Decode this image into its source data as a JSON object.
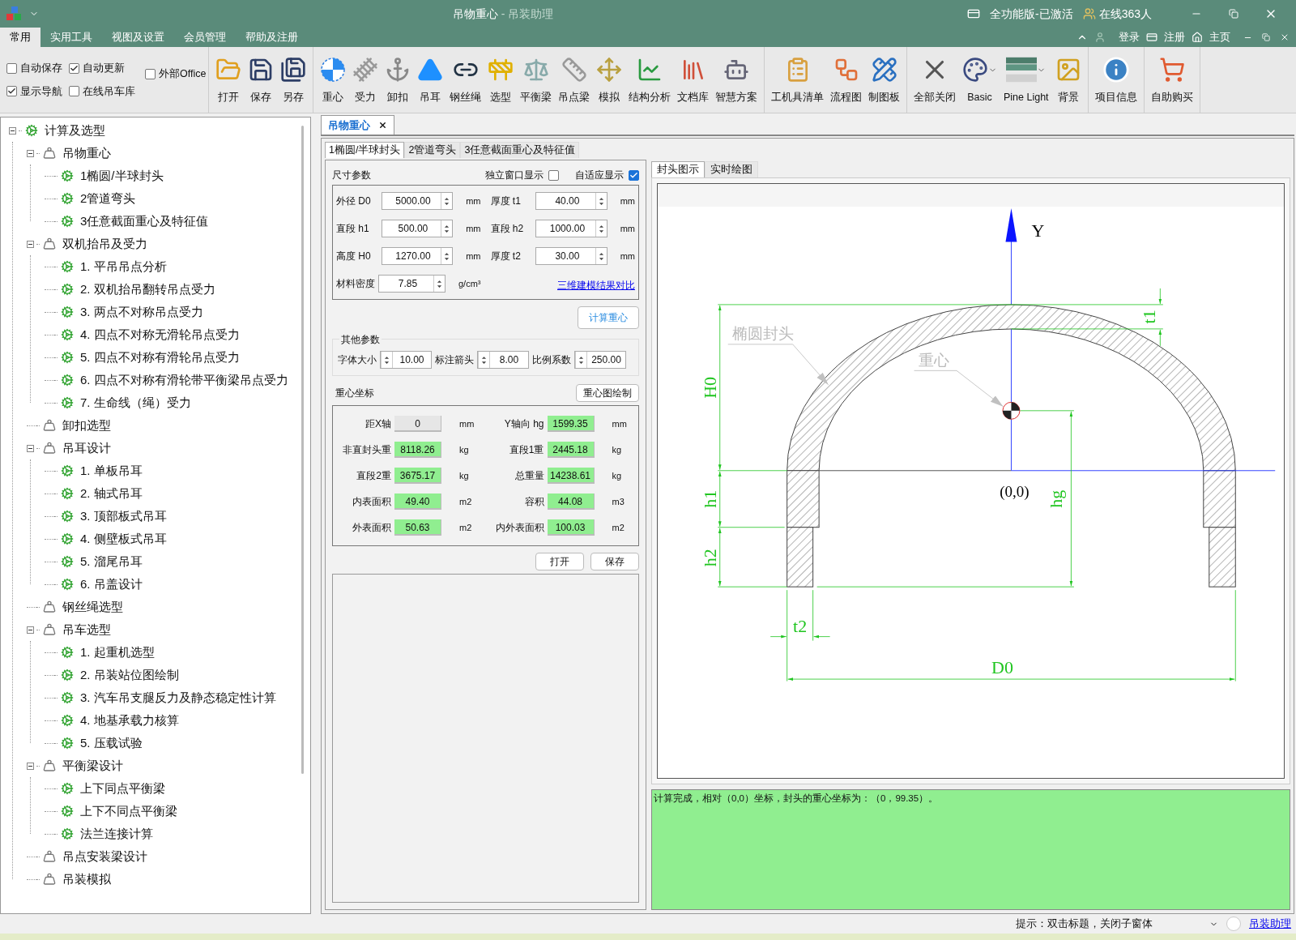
{
  "title_bar": {
    "title": "吊物重心",
    "subtitle": " - 吊装助理",
    "license": "全功能版-已激活",
    "online": "在线363人"
  },
  "ribbon_tabs": [
    {
      "label": "常用",
      "selected": true
    },
    {
      "label": "实用工具",
      "selected": false
    },
    {
      "label": "视图及设置",
      "selected": false
    },
    {
      "label": "会员管理",
      "selected": false
    },
    {
      "label": "帮助及注册",
      "selected": false
    }
  ],
  "account": {
    "login": "登录",
    "register": "注册",
    "home": "主页"
  },
  "ribbon_checks": [
    {
      "label": "自动保存",
      "checked": false
    },
    {
      "label": "自动更新",
      "checked": true
    },
    {
      "label": "外部Office",
      "checked": false
    },
    {
      "label": "显示导航",
      "checked": true
    },
    {
      "label": "在线吊车库",
      "checked": false
    }
  ],
  "ribbon_groups": [
    [
      {
        "label": "打开",
        "kind": "button"
      },
      {
        "label": "保存",
        "kind": "button"
      },
      {
        "label": "另存",
        "kind": "button"
      }
    ],
    [
      {
        "label": "重心",
        "kind": "button"
      },
      {
        "label": "受力",
        "kind": "button"
      },
      {
        "label": "卸扣",
        "kind": "button"
      },
      {
        "label": "吊耳",
        "kind": "button"
      },
      {
        "label": "钢丝绳",
        "kind": "button"
      },
      {
        "label": "选型",
        "kind": "button"
      },
      {
        "label": "平衡梁",
        "kind": "button"
      },
      {
        "label": "吊点梁",
        "kind": "button"
      },
      {
        "label": "模拟",
        "kind": "button"
      },
      {
        "label": "结构分析",
        "kind": "button"
      },
      {
        "label": "文档库",
        "kind": "button"
      },
      {
        "label": "智慧方案",
        "kind": "button"
      }
    ],
    [
      {
        "label": "工机具清单",
        "kind": "button"
      },
      {
        "label": "流程图",
        "kind": "button"
      },
      {
        "label": "制图板",
        "kind": "button"
      }
    ],
    [
      {
        "label": "全部关闭",
        "kind": "button"
      },
      {
        "label": "Basic",
        "kind": "dropdown"
      },
      {
        "label": "Pine Light",
        "kind": "dropdown"
      },
      {
        "label": "背景",
        "kind": "button"
      }
    ],
    [
      {
        "label": "项目信息",
        "kind": "button"
      }
    ],
    [
      {
        "label": "自助购买",
        "kind": "button"
      }
    ]
  ],
  "tree": [
    {
      "label": "计算及选型",
      "expanded": true,
      "children": [
        {
          "label": "吊物重心",
          "expanded": true,
          "children": [
            {
              "label": "1椭圆/半球封头"
            },
            {
              "label": "2管道弯头"
            },
            {
              "label": "3任意截面重心及特征值"
            }
          ]
        },
        {
          "label": "双机抬吊及受力",
          "expanded": true,
          "children": [
            {
              "label": "1. 平吊吊点分析"
            },
            {
              "label": "2. 双机抬吊翻转吊点受力"
            },
            {
              "label": "3. 两点不对称吊点受力"
            },
            {
              "label": "4. 四点不对称无滑轮吊点受力"
            },
            {
              "label": "5. 四点不对称有滑轮吊点受力"
            },
            {
              "label": "6. 四点不对称有滑轮带平衡梁吊点受力"
            },
            {
              "label": "7. 生命线（绳）受力"
            }
          ]
        },
        {
          "label": "卸扣选型"
        },
        {
          "label": "吊耳设计",
          "expanded": true,
          "children": [
            {
              "label": "1. 单板吊耳"
            },
            {
              "label": "2. 轴式吊耳"
            },
            {
              "label": "3. 顶部板式吊耳"
            },
            {
              "label": "4. 侧壁板式吊耳"
            },
            {
              "label": "5. 溜尾吊耳"
            },
            {
              "label": "6. 吊盖设计"
            }
          ]
        },
        {
          "label": "钢丝绳选型"
        },
        {
          "label": "吊车选型",
          "expanded": true,
          "children": [
            {
              "label": "1. 起重机选型"
            },
            {
              "label": "2. 吊装站位图绘制"
            },
            {
              "label": "3. 汽车吊支腿反力及静态稳定性计算"
            },
            {
              "label": "4. 地基承载力核算"
            },
            {
              "label": "5. 压载试验"
            }
          ]
        },
        {
          "label": "平衡梁设计",
          "expanded": true,
          "children": [
            {
              "label": "上下同点平衡梁"
            },
            {
              "label": "上下不同点平衡梁"
            },
            {
              "label": "法兰连接计算"
            }
          ]
        },
        {
          "label": "吊点安装梁设计"
        },
        {
          "label": "吊装模拟"
        }
      ]
    }
  ],
  "document_tab": {
    "label": "吊物重心"
  },
  "sub_tabs": [
    {
      "label": "1椭圆/半球封头",
      "selected": true
    },
    {
      "label": "2管道弯头",
      "selected": false
    },
    {
      "label": "3任意截面重心及特征值",
      "selected": false
    }
  ],
  "size_params": {
    "title": "尺寸参数",
    "checks": [
      {
        "label": "独立窗口显示",
        "checked": false
      },
      {
        "label": "自适应显示",
        "checked": true
      }
    ],
    "fields": [
      {
        "label": "外径 D0",
        "value": "5000.00",
        "unit": "mm"
      },
      {
        "label": "厚度 t1",
        "value": "40.00",
        "unit": "mm"
      },
      {
        "label": "直段 h1",
        "value": "500.00",
        "unit": "mm"
      },
      {
        "label": "直段 h2",
        "value": "1000.00",
        "unit": "mm"
      },
      {
        "label": "高度 H0",
        "value": "1270.00",
        "unit": "mm"
      },
      {
        "label": "厚度 t2",
        "value": "30.00",
        "unit": "mm"
      },
      {
        "label": "材料密度",
        "value": "7.85",
        "unit": "g/cm³"
      }
    ],
    "link": "三维建模结果对比"
  },
  "calc_button": "计算重心",
  "other_params": {
    "title": "其他参数",
    "fields": [
      {
        "label": "字体大小",
        "value": "10.00"
      },
      {
        "label": "标注箭头",
        "value": "8.00"
      },
      {
        "label": "比例系数",
        "value": "250.00"
      }
    ]
  },
  "centroid": {
    "title": "重心坐标",
    "button": "重心图绘制",
    "results": [
      {
        "label": "距X轴",
        "value": "0",
        "unit": "mm",
        "highlighted": false
      },
      {
        "label": "Y轴向 hg",
        "value": "1599.35",
        "unit": "mm",
        "highlighted": true
      },
      {
        "label": "非直封头重",
        "value": "8118.26",
        "unit": "kg",
        "highlighted": true
      },
      {
        "label": "直段1重",
        "value": "2445.18",
        "unit": "kg",
        "highlighted": true
      },
      {
        "label": "直段2重",
        "value": "3675.17",
        "unit": "kg",
        "highlighted": true
      },
      {
        "label": "总重量",
        "value": "14238.61",
        "unit": "kg",
        "highlighted": true
      },
      {
        "label": "内表面积",
        "value": "49.40",
        "unit": "m2",
        "highlighted": true
      },
      {
        "label": "容积",
        "value": "44.08",
        "unit": "m3",
        "highlighted": true
      },
      {
        "label": "外表面积",
        "value": "50.63",
        "unit": "m2",
        "highlighted": true
      },
      {
        "label": "内外表面积",
        "value": "100.03",
        "unit": "m2",
        "highlighted": true
      }
    ]
  },
  "form_buttons": [
    "打开",
    "保存"
  ],
  "diagram": {
    "tabs": [
      {
        "label": "封头图示",
        "selected": true
      },
      {
        "label": "实时绘图",
        "selected": false
      }
    ],
    "labels": {
      "y_axis": "Y",
      "head": "椭圆封头",
      "centroid": "重心",
      "origin": "(0,0)",
      "H0": "H0",
      "t1": "t1",
      "h1": "h1",
      "h2": "h2",
      "hg": "hg",
      "t2": "t2",
      "D0": "D0"
    }
  },
  "message": "计算完成，相对（0,0）坐标，封头的重心坐标为：（0，99.35）。",
  "status_bar": {
    "hint": "提示：双击标题，关闭子窗体",
    "link": "吊装助理"
  }
}
